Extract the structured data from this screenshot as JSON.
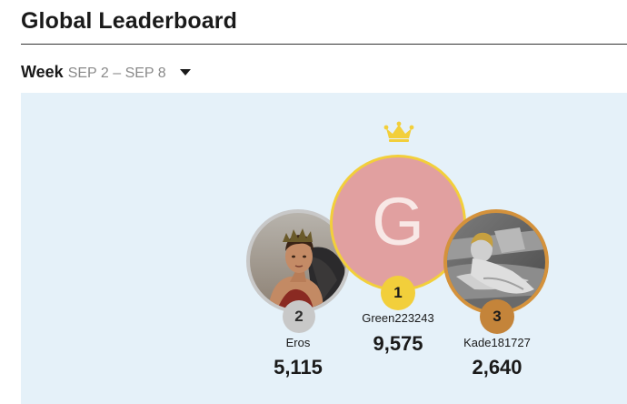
{
  "header": {
    "title": "Global Leaderboard"
  },
  "period": {
    "label": "Week",
    "range": "SEP 2 – SEP 8",
    "dropdown_icon": "chevron-down-icon"
  },
  "podium": {
    "crown_icon": "crown-icon",
    "crown_color": "#f2cf3b",
    "entries": [
      {
        "rank": "1",
        "name": "Green223243",
        "score": "9,575",
        "avatar_initial": "G",
        "avatar_color": "#e1a0a0",
        "ring_color": "#f2cf3b"
      },
      {
        "rank": "2",
        "name": "Eros",
        "score": "5,115",
        "avatar_color": "#c8c8c8",
        "ring_color": "#c8c8c8"
      },
      {
        "rank": "3",
        "name": "Kade181727",
        "score": "2,640",
        "avatar_color": "#d4923c",
        "ring_color": "#c4843a"
      }
    ]
  },
  "colors": {
    "board_background": "#e5f1f9",
    "text": "#1a1a1a",
    "muted_text": "#8a8a8a"
  }
}
